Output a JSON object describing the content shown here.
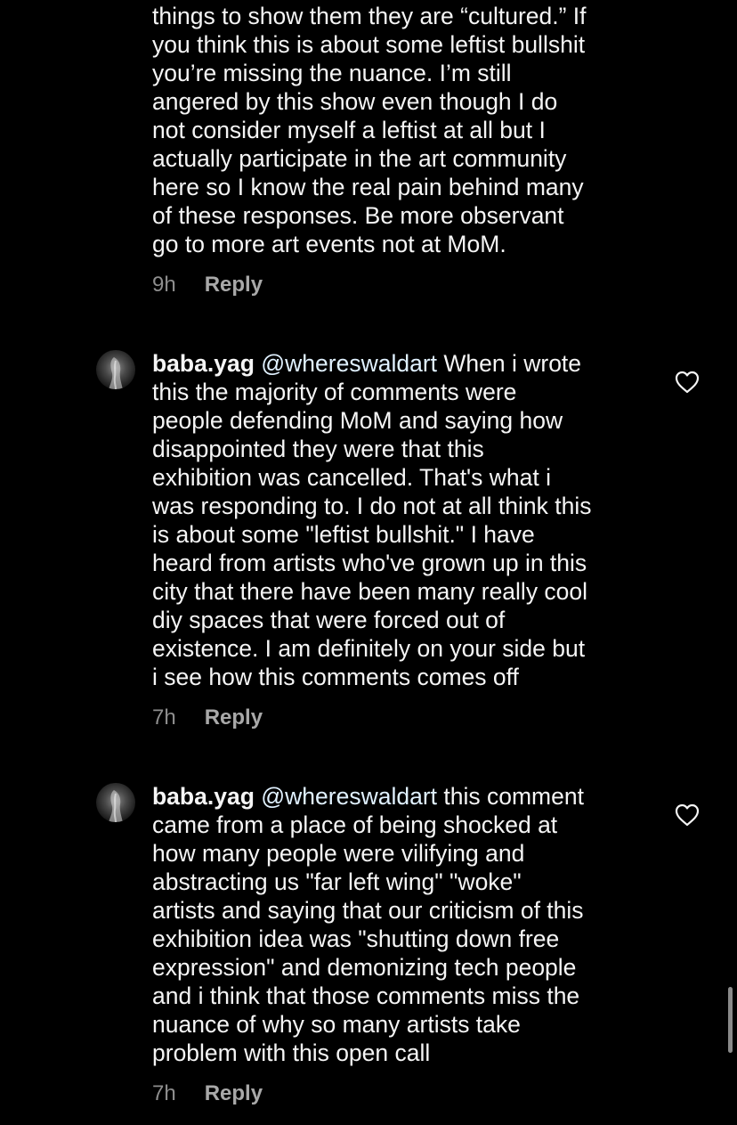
{
  "comments": [
    {
      "username": "",
      "mention": "",
      "text": "things to show them they are “cultured.” If\nyou think this is about some leftist bullshit\nyou’re missing the nuance. I’m still\nangered by this show even though I do\nnot consider myself a leftist at all but I\nactually participate in the art community\nhere so I know the real pain behind many\nof these responses. Be more observant\ngo to more art events not at MoM.",
      "time": "9h",
      "reply_label": "Reply"
    },
    {
      "username": "baba.yag",
      "mention": "@whereswaldart",
      "text": " When i wrote\nthis the majority of comments were\npeople defending MoM and saying how\ndisappointed they were that this\nexhibition was cancelled. That's what i\nwas responding to. I do not at all think this\nis about some \"leftist bullshit.\" I have\nheard from artists who've grown up in this\ncity that there have been many really cool\ndiy spaces that were forced out of\nexistence. I am definitely on your side but\ni see how this comments comes off",
      "time": "7h",
      "reply_label": "Reply",
      "avatar_icon": "user-avatar",
      "like_icon": "heart-outline-icon"
    },
    {
      "username": "baba.yag",
      "mention": "@whereswaldart",
      "text": " this comment\ncame from a place of being shocked at\nhow many people were vilifying and\nabstracting us \"far left wing\" \"woke\"\nartists and saying that our criticism of this\nexhibition idea was \"shutting down free\nexpression\" and demonizing tech people\nand i think that those comments miss the\nnuance of why so many artists take\nproblem with this open call",
      "time": "7h",
      "reply_label": "Reply",
      "avatar_icon": "user-avatar",
      "like_icon": "heart-outline-icon"
    }
  ],
  "colors": {
    "background": "#000000",
    "text": "#f5f5f5",
    "mention": "#e0f1ff",
    "meta": "#8e8e8e",
    "reply": "#a8a8a8"
  }
}
